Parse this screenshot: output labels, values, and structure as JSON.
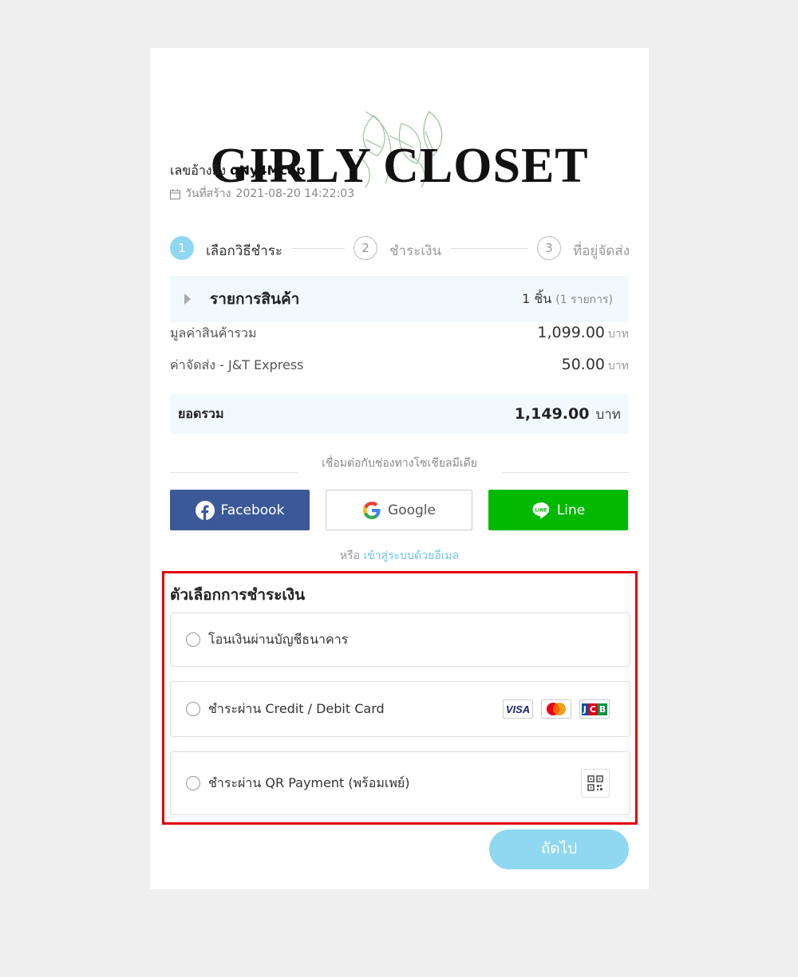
{
  "brand": {
    "name": "GIRLY CLOSET"
  },
  "order": {
    "ref_label": "เลขอ้างอิง",
    "ref_code": "qNy4Mc8p",
    "created_label": "วันที่สร้าง",
    "created_value": "2021-08-20 14:22:03"
  },
  "steps": [
    {
      "num": "1",
      "label": "เลือกวิธีชำระ"
    },
    {
      "num": "2",
      "label": "ชำระเงิน"
    },
    {
      "num": "3",
      "label": "ที่อยู่จัดส่ง"
    }
  ],
  "items": {
    "title": "รายการสินค้า",
    "count": "1 ชิ้น",
    "count_detail": "(1 รายการ)"
  },
  "summary": {
    "subtotal_label": "มูลค่าสินค้ารวม",
    "subtotal_value": "1,099.00",
    "shipping_label": "ค่าจัดส่ง - J&T Express",
    "shipping_value": "50.00",
    "currency": "บาท",
    "total_label": "ยอดรวม",
    "total_value": "1,149.00"
  },
  "social": {
    "heading": "เชื่อมต่อกับช่องทางโซเชียลมีเดีย",
    "facebook": "Facebook",
    "google": "Google",
    "line": "Line",
    "or_text": "หรือ",
    "email_link": "เข้าสู่ระบบด้วยอีเมล"
  },
  "payment": {
    "title": "ตัวเลือกการชำระเงิน",
    "options": [
      {
        "label": "โอนเงินผ่านบัญชีธนาคาร"
      },
      {
        "label": "ชำระผ่าน Credit / Debit Card"
      },
      {
        "label": "ชำระผ่าน QR Payment (พร้อมเพย์)"
      }
    ],
    "card_brands": [
      "VISA",
      "MasterCard",
      "JCB"
    ]
  },
  "next_button": "ถัดไป",
  "colors": {
    "accent": "#8fd8ef",
    "facebook": "#3b5998",
    "line": "#00b900",
    "highlight": "#e00000"
  }
}
